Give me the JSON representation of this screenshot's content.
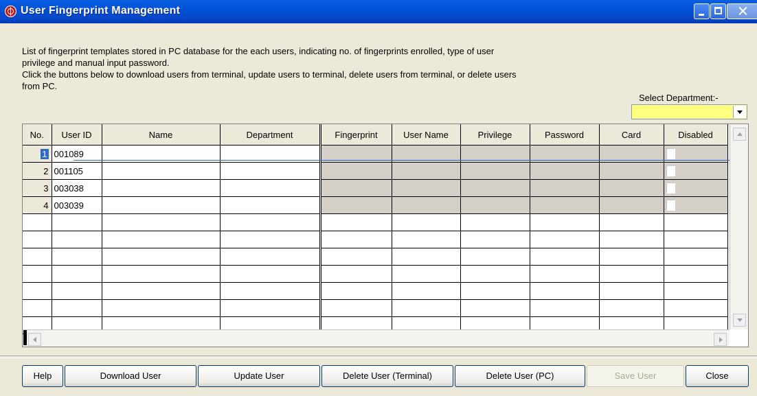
{
  "window": {
    "title": "User Fingerprint Management"
  },
  "description": "List of fingerprint templates stored in PC database for the each users, indicating no. of fingerprints enrolled, type of user\nprivilege and manual input password.\nClick the buttons below to download users from terminal, update users to terminal, delete users from terminal, or delete users\nfrom PC.",
  "department": {
    "label": "Select Department:-",
    "value": ""
  },
  "grid": {
    "columns": [
      "No.",
      "User ID",
      "Name",
      "Department",
      "Fingerprint",
      "User Name",
      "Privilege",
      "Password",
      "Card",
      "Disabled"
    ],
    "rows": [
      {
        "no": "1",
        "user_id": "001089",
        "name": "",
        "department": "",
        "fingerprint": "",
        "user_name": "",
        "privilege": "",
        "password": "",
        "card": "",
        "disabled": false
      },
      {
        "no": "2",
        "user_id": "001105",
        "name": "",
        "department": "",
        "fingerprint": "",
        "user_name": "",
        "privilege": "",
        "password": "",
        "card": "",
        "disabled": false
      },
      {
        "no": "3",
        "user_id": "003038",
        "name": "",
        "department": "",
        "fingerprint": "",
        "user_name": "",
        "privilege": "",
        "password": "",
        "card": "",
        "disabled": false
      },
      {
        "no": "4",
        "user_id": "003039",
        "name": "",
        "department": "",
        "fingerprint": "",
        "user_name": "",
        "privilege": "",
        "password": "",
        "card": "",
        "disabled": false
      }
    ],
    "empty_rows": 7,
    "selected_row": 1
  },
  "buttons": {
    "help": "Help",
    "download": "Download User",
    "update": "Update User",
    "delete_terminal": "Delete User (Terminal)",
    "delete_pc": "Delete User (PC)",
    "save": "Save User",
    "close": "Close"
  },
  "colors": {
    "titlebar": "#0a5fe3",
    "selection": "#316ac5",
    "department_field": "#ffff80",
    "readonly_cells": "#d4d0c8"
  }
}
